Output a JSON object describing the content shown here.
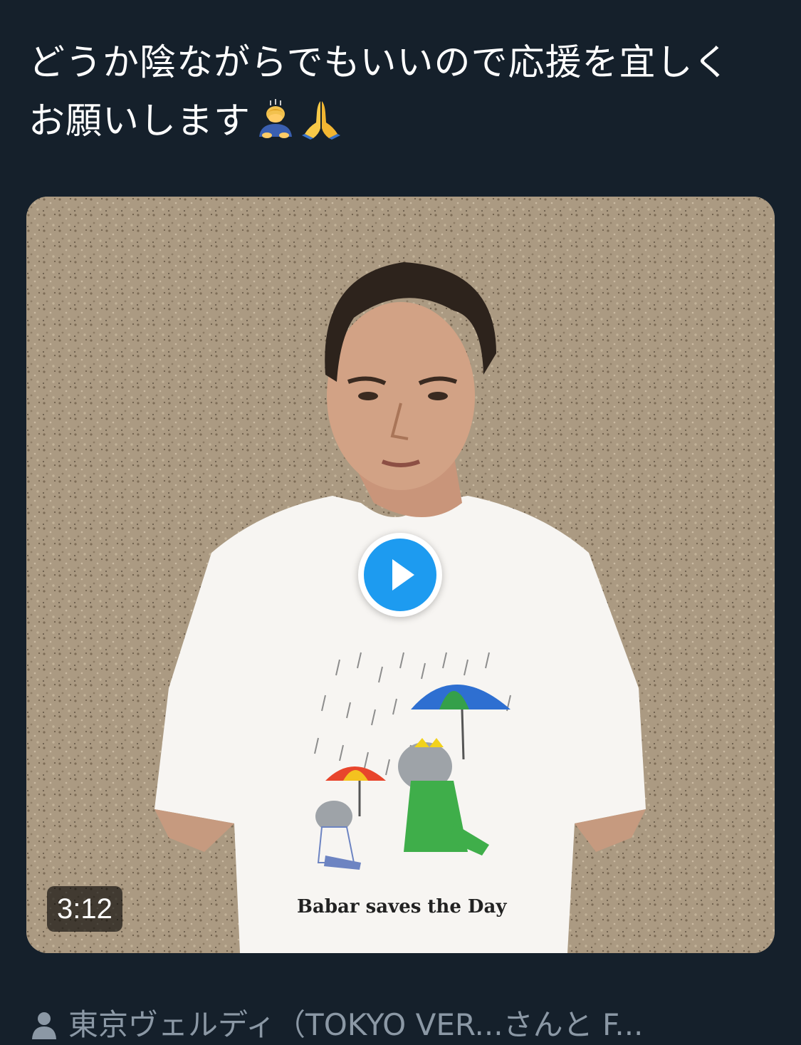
{
  "tweet": {
    "text_line1": "どうか陰ながらでもいいので応援を宜しく",
    "text_line2": "お願いします",
    "emojis": [
      "person-bowing-icon",
      "folded-hands-icon"
    ]
  },
  "media": {
    "video_duration": "3:12",
    "shirt_caption": "Babar saves the Day",
    "play_icon": "play-icon"
  },
  "footer": {
    "icon": "person-icon",
    "tagged_users": "東京ヴェルディ（TOKYO VER...さんと F..."
  },
  "colors": {
    "background": "#15202b",
    "text": "#ffffff",
    "secondary_text": "#8b98a5",
    "accent": "#1d9bf0"
  }
}
